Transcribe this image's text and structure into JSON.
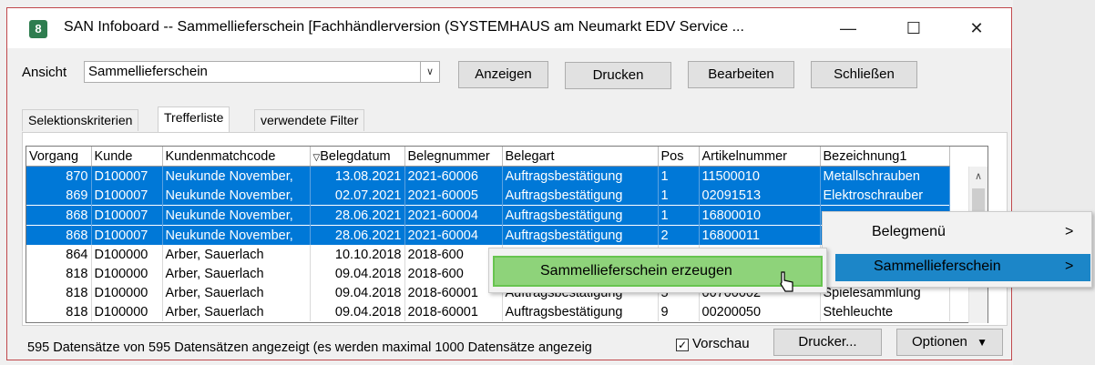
{
  "window": {
    "title": "SAN Infoboard -- Sammellieferschein [Fachhändlerversion (SYSTEMHAUS am Neumarkt EDV Service ...",
    "app_icon": "8",
    "controls": {
      "minimize": "—",
      "maximize": "☐",
      "close": "✕"
    }
  },
  "toolbar": {
    "ansicht_label": "Ansicht",
    "ansicht_value": "Sammellieferschein",
    "anzeigen": "Anzeigen",
    "drucken": "Drucken",
    "bearbeiten": "Bearbeiten",
    "schliessen": "Schließen"
  },
  "tabs": [
    "Selektionskriterien",
    "Trefferliste",
    "verwendete Filter"
  ],
  "grid": {
    "headers": [
      "Vorgang",
      "Kunde",
      "Kundenmatchcode",
      "Belegdatum",
      "Belegnummer",
      "Belegart",
      "Pos",
      "Artikelnummer",
      "Bezeichnung1"
    ],
    "sort_mark": "▽",
    "rows": [
      [
        "870",
        "D100007",
        "Neukunde November,",
        "13.08.2021",
        "2021-60006",
        "Auftragsbestätigung",
        "1",
        "11500010",
        "Metallschrauben"
      ],
      [
        "869",
        "D100007",
        "Neukunde November,",
        "02.07.2021",
        "2021-60005",
        "Auftragsbestätigung",
        "1",
        "02091513",
        "Elektroschrauber"
      ],
      [
        "868",
        "D100007",
        "Neukunde November,",
        "28.06.2021",
        "2021-60004",
        "Auftragsbestätigung",
        "1",
        "16800010",
        ""
      ],
      [
        "868",
        "D100007",
        "Neukunde November,",
        "28.06.2021",
        "2021-60004",
        "Auftragsbestätigung",
        "2",
        "16800011",
        ""
      ],
      [
        "864",
        "D100000",
        "Arber, Sauerlach",
        "10.10.2018",
        "2018-600",
        "",
        "",
        "",
        ""
      ],
      [
        "818",
        "D100000",
        "Arber, Sauerlach",
        "09.04.2018",
        "2018-600",
        "",
        "",
        "",
        ""
      ],
      [
        "818",
        "D100000",
        "Arber, Sauerlach",
        "09.04.2018",
        "2018-60001",
        "Auftragsbestätigung",
        "5",
        "00700002",
        "Spielesammlung"
      ],
      [
        "818",
        "D100000",
        "Arber, Sauerlach",
        "09.04.2018",
        "2018-60001",
        "Auftragsbestätigung",
        "9",
        "00200050",
        "Stehleuchte"
      ]
    ]
  },
  "context_menu": {
    "belegmenue": "Belegmenü",
    "sammellieferschein": "Sammellieferschein",
    "submenu_item": "Sammellieferschein erzeugen",
    "chevron": ">"
  },
  "footer": {
    "status": "595 Datensätze von 595 Datensätzen angezeigt (es werden maximal 1000 Datensätze angezeig",
    "vorschau": "Vorschau",
    "drucker": "Drucker...",
    "optionen": "Optionen"
  },
  "colors": {
    "selection": "#0078d7",
    "window_border": "#c0474b",
    "menu_green": "#8ed37a",
    "menu_blue": "#1c86c8"
  },
  "icons": [
    "app-icon",
    "dropdown-arrow-icon",
    "sort-icon",
    "chevron-right-icon",
    "caret-down-icon",
    "checkbox-checked-icon",
    "pointer-cursor-icon"
  ]
}
